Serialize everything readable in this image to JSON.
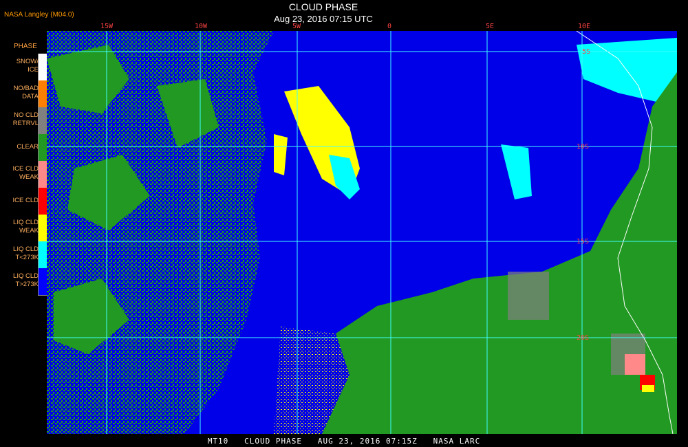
{
  "header": {
    "credit": "NASA Langley (M04.0)",
    "title": "CLOUD PHASE",
    "datetime": "Aug 23, 2016 07:15 UTC"
  },
  "longitude_labels": [
    "15W",
    "10W",
    "5W",
    "0",
    "5E",
    "10E"
  ],
  "latitude_labels": [
    "5S",
    "10S",
    "15S",
    "20S"
  ],
  "legend": {
    "title": "PHASE",
    "items": [
      {
        "label": "SNOW/\nICE",
        "color": "#ffffff"
      },
      {
        "label": "NO/BAD\nDATA",
        "color": "#ff8000"
      },
      {
        "label": "NO CLD\nRETRVL",
        "color": "#808080"
      },
      {
        "label": "CLEAR",
        "color": "#229922"
      },
      {
        "label": "ICE CLD\nWEAK",
        "color": "#ff8888"
      },
      {
        "label": "ICE CLD",
        "color": "#ff0000"
      },
      {
        "label": "LIQ CLD\nWEAK",
        "color": "#ffff00"
      },
      {
        "label": "LIQ CLD\nT<273K",
        "color": "#00ffff"
      },
      {
        "label": "LIQ CLD\nT>273K",
        "color": "#0000ff"
      }
    ]
  },
  "footer": "MT10   CLOUD PHASE   AUG 23, 2016 07:15Z   NASA LARC"
}
